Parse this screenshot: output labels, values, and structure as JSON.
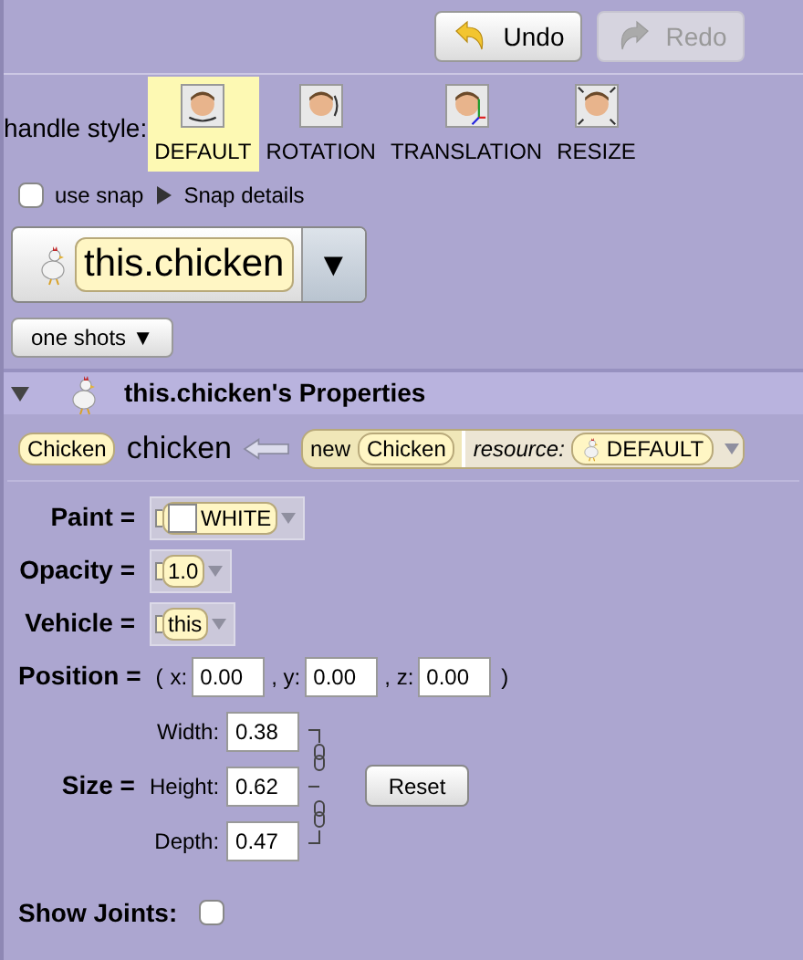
{
  "toolbar": {
    "buttons": [
      {
        "label": "Undo",
        "kind": "undo",
        "disabled": false
      },
      {
        "label": "Redo",
        "kind": "redo",
        "disabled": true
      }
    ]
  },
  "handle_style": {
    "label": "handle style:",
    "options": [
      {
        "label": "DEFAULT",
        "selected": true
      },
      {
        "label": "ROTATION",
        "selected": false
      },
      {
        "label": "TRANSLATION",
        "selected": false
      },
      {
        "label": "RESIZE",
        "selected": false
      }
    ]
  },
  "snap": {
    "label": "use snap",
    "checked": false,
    "details": "Snap details",
    "expanded": false
  },
  "selector": {
    "value": "this.chicken",
    "arrow": "▼"
  },
  "one_shots": {
    "label": "one shots",
    "arrow": "▼"
  },
  "properties": {
    "title": "this.chicken's Properties",
    "expanded": true,
    "declaration": {
      "type": "Chicken",
      "name": "chicken",
      "keyword": "new",
      "ctor_type": "Chicken",
      "param_label": "resource:",
      "param_value": "DEFAULT"
    },
    "rows": [
      {
        "kind": "color",
        "label": "Paint =",
        "value": "WHITE",
        "color": "#ffffff"
      },
      {
        "kind": "number",
        "label": "Opacity =",
        "value": "1.0"
      },
      {
        "kind": "object",
        "label": "Vehicle =",
        "value": "this"
      }
    ],
    "position": {
      "label": "Position =",
      "open": "(",
      "fields": [
        {
          "label": "x:",
          "value": "0.00"
        },
        {
          "label": ", y:",
          "value": "0.00"
        },
        {
          "label": ", z:",
          "value": "0.00"
        }
      ],
      "close": ")"
    },
    "size": {
      "label": "Size =",
      "fields": [
        {
          "label": "Width:",
          "value": "0.38"
        },
        {
          "label": "Height:",
          "value": "0.62"
        },
        {
          "label": "Depth:",
          "value": "0.47"
        }
      ],
      "reset": "Reset"
    },
    "show_joints": {
      "label": "Show Joints:",
      "checked": false
    }
  }
}
